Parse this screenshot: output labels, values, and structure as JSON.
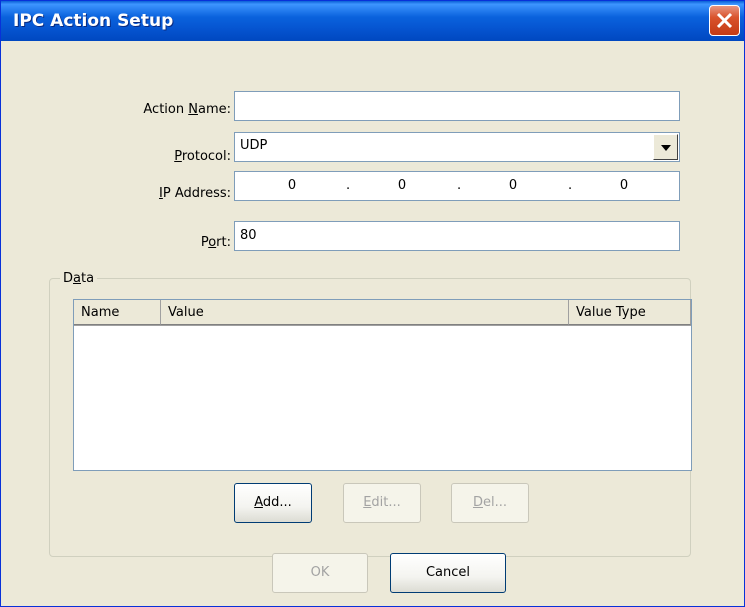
{
  "window": {
    "title": "IPC Action Setup"
  },
  "form": {
    "action_name": {
      "label": "Action Name:",
      "value": ""
    },
    "protocol": {
      "label": "Protocol:",
      "value": "UDP"
    },
    "ip_address": {
      "label": "IP Address:",
      "octets": [
        "0",
        "0",
        "0",
        "0"
      ],
      "separator": "."
    },
    "port": {
      "label": "Port:",
      "value": "80"
    }
  },
  "data_group": {
    "title": "Data",
    "columns": [
      "Name",
      "Value",
      "Value Type"
    ],
    "rows": []
  },
  "buttons": {
    "add": "Add...",
    "edit": "Edit...",
    "del": "Del...",
    "ok": "OK",
    "cancel": "Cancel"
  }
}
